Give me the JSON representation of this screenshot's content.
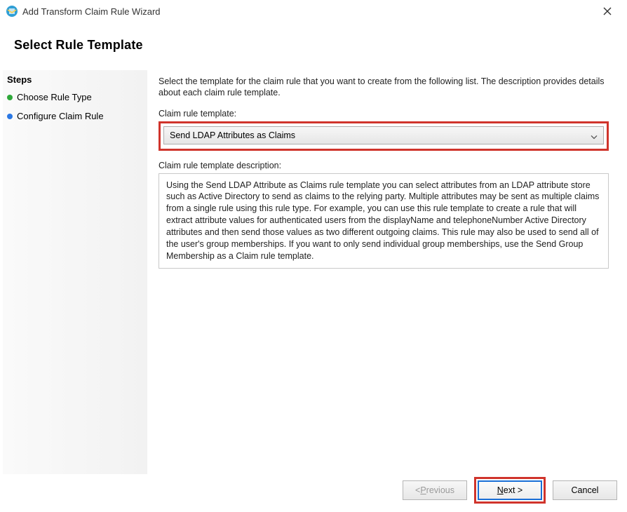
{
  "window": {
    "title": "Add Transform Claim Rule Wizard"
  },
  "header": {
    "title": "Select Rule Template"
  },
  "sidebar": {
    "title": "Steps",
    "items": [
      {
        "label": "Choose Rule Type",
        "state": "done"
      },
      {
        "label": "Configure Claim Rule",
        "state": "current"
      }
    ]
  },
  "main": {
    "intro": "Select the template for the claim rule that you want to create from the following list. The description provides details about each claim rule template.",
    "template_label": "Claim rule template:",
    "template_selected": "Send LDAP Attributes as Claims",
    "description_label": "Claim rule template description:",
    "description_text": "Using the Send LDAP Attribute as Claims rule template you can select attributes from an LDAP attribute store such as Active Directory to send as claims to the relying party. Multiple attributes may be sent as multiple claims from a single rule using this rule type. For example, you can use this rule template to create a rule that will extract attribute values for authenticated users from the displayName and telephoneNumber Active Directory attributes and then send those values as two different outgoing claims. This rule may also be used to send all of the user's group memberships. If you want to only send individual group memberships, use the Send Group Membership as a Claim rule template."
  },
  "footer": {
    "previous_prefix": "< ",
    "previous_ul": "P",
    "previous_rest": "revious",
    "next_ul": "N",
    "next_rest": "ext >",
    "cancel": "Cancel"
  }
}
